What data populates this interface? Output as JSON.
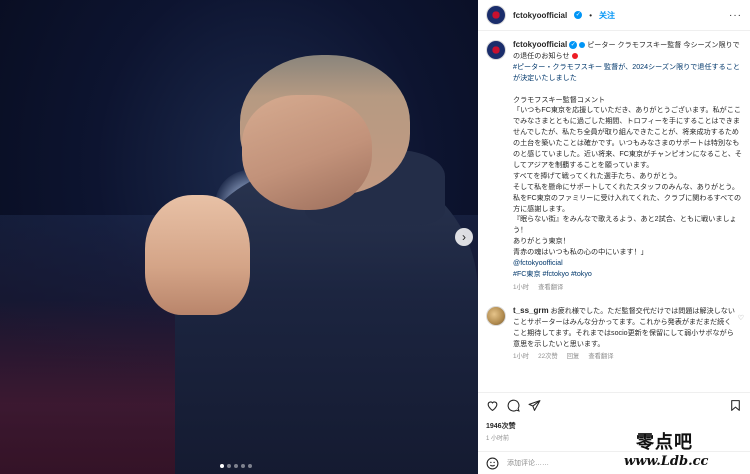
{
  "post": {
    "username": "fctokyoofficial",
    "follow_label": "关注",
    "more_icon": "more-horizontal-icon",
    "caption_first_line": "ピーター クラモフスキー監督 今シーズン限りでの退任のお知らせ",
    "caption_lines": [
      "#ピーター・クラモフスキー 監督が、2024シーズン限りで退任することが決定いたしました",
      "",
      "クラモフスキー監督コメント",
      "「いつもFC東京を応援していただき、ありがとうございます。私がここでみなさまとともに過ごした期間、トロフィーを手にすることはできませんでしたが、私たち全員が取り組んできたことが、将来成功するための土台を築いたことは確かです。いつもみなさまのサポートは特別なものと感じていました。近い将来、FC東京がチャンピオンになること、そしてアジアを制覇することを願っています。",
      "すべてを捧げて戦ってくれた選手たち、ありがとう。",
      "そして私を懸命にサポートしてくれたスタッフのみんな、ありがとう。",
      "私をFC東京のファミリーに受け入れてくれた、クラブに関わるすべての方に感謝します。",
      "『眠らない街』をみんなで歌えるよう、あと2試合、ともに戦いましょう！",
      "ありがとう東京！",
      "青赤の魂はいつも私の心の中にいます！」"
    ],
    "caption_tags": [
      "@fctokyoofficial",
      "#FC東京 #fctokyo #tokyo"
    ],
    "caption_meta": {
      "time": "1小时",
      "translate": "查看翻译"
    },
    "comment": {
      "username": "t_ss_grm",
      "text": "お疲れ様でした。ただ監督交代だけでは問題は解決しないことサポーターはみんな分かってます。これから発表がまだまだ続くこと期待してます。それまではsocio更新を保留にして弱小サポながら意思を示したいと思います。",
      "time": "1小时",
      "likes": "22次赞",
      "reply": "回复",
      "translate": "查看翻译"
    },
    "likes_count": "1946次赞",
    "post_time": "1 小时前",
    "add_comment_placeholder": "添加评论……"
  },
  "watermark": {
    "name": "零点吧",
    "url": "www.Ldb.cc"
  }
}
